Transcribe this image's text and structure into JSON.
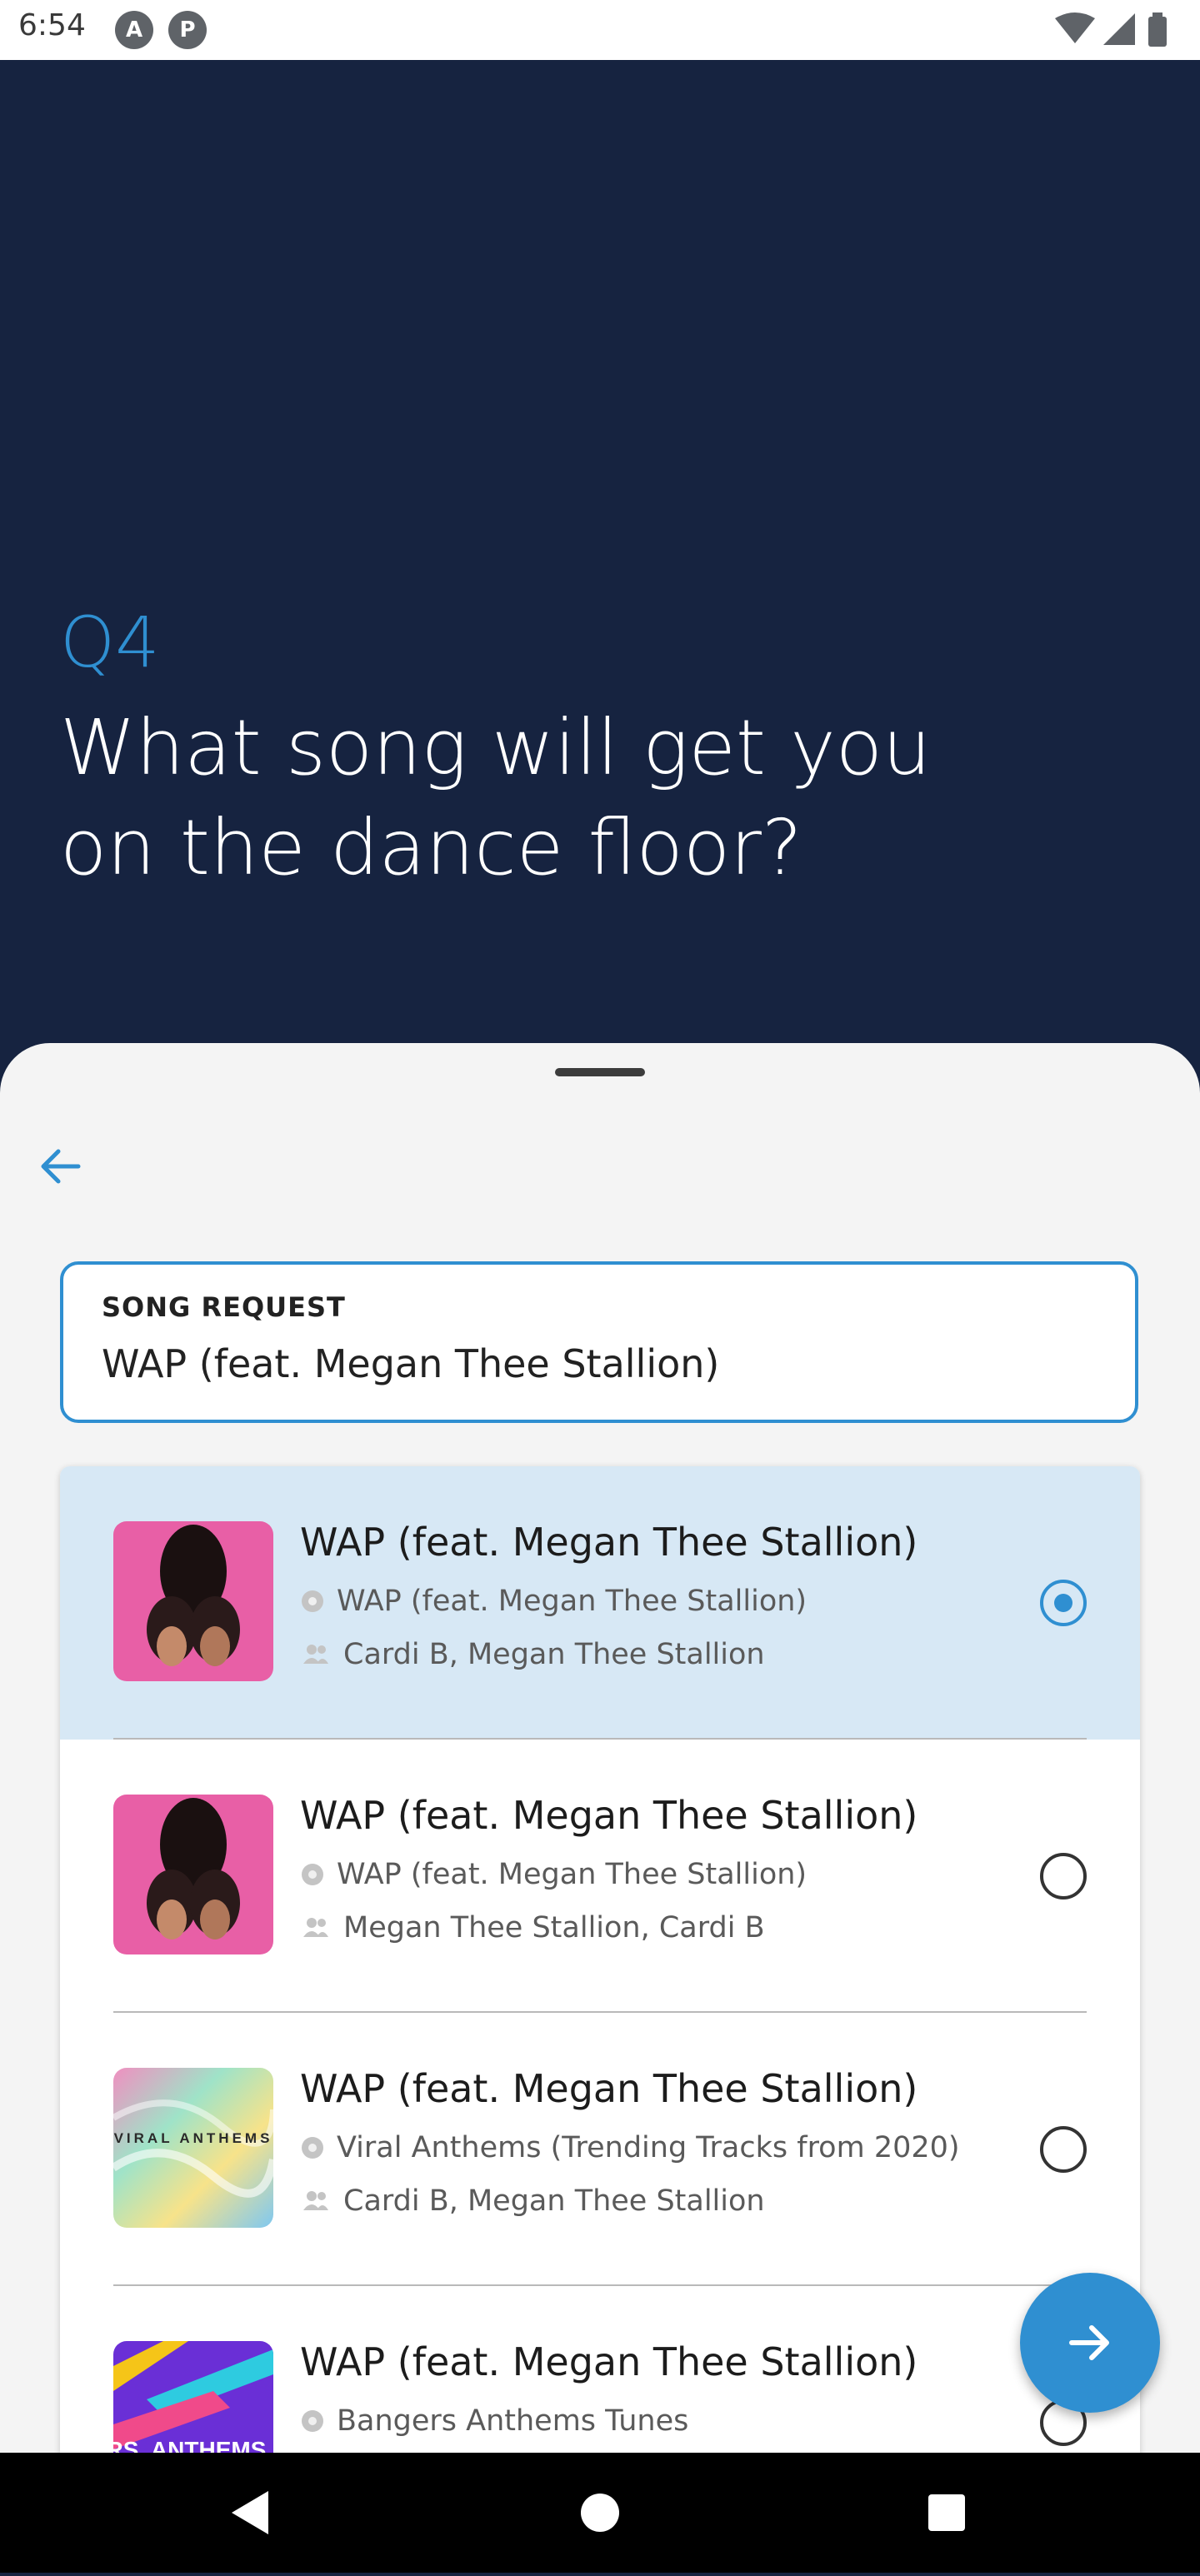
{
  "status_bar": {
    "time": "6:54",
    "app_icons": [
      "A",
      "P"
    ]
  },
  "question": {
    "number": "Q4",
    "line1": "What song will get you",
    "line2": "on the dance floor?"
  },
  "song_field": {
    "label": "SONG REQUEST",
    "value": "WAP (feat. Megan Thee Stallion)"
  },
  "results": [
    {
      "title": "WAP (feat. Megan Thee Stallion)",
      "album": "WAP (feat. Megan Thee Stallion)",
      "artists": "Cardi B, Megan Thee Stallion",
      "selected": true,
      "art": "wap"
    },
    {
      "title": "WAP (feat. Megan Thee Stallion)",
      "album": "WAP (feat. Megan Thee Stallion)",
      "artists": "Megan Thee Stallion, Cardi B",
      "selected": false,
      "art": "wap"
    },
    {
      "title": "WAP (feat. Megan Thee Stallion)",
      "album": "Viral Anthems (Trending Tracks from 2020)",
      "artists": "Cardi B, Megan Thee Stallion",
      "selected": false,
      "art": "viral",
      "art_text": "VIRAL ANTHEMS"
    },
    {
      "title": "WAP (feat. Megan Thee Stallion)",
      "album": "Bangers Anthems Tunes",
      "artists": "",
      "selected": false,
      "art": "bangers",
      "art_text": "BANGERS. ANTHEMS. TUNES."
    }
  ],
  "colors": {
    "header_bg": "#162340",
    "accent": "#2f8fd1",
    "selected_bg": "#d7e8f5",
    "sheet_bg": "#f4f4f4"
  },
  "icons": {
    "back": "arrow-left-icon",
    "next": "arrow-right-icon",
    "album": "disc-icon",
    "artists": "people-icon",
    "wifi": "wifi-icon",
    "signal": "signal-icon",
    "battery": "battery-icon",
    "nav_back": "triangle-back-icon",
    "nav_home": "circle-home-icon",
    "nav_recents": "square-recents-icon"
  }
}
